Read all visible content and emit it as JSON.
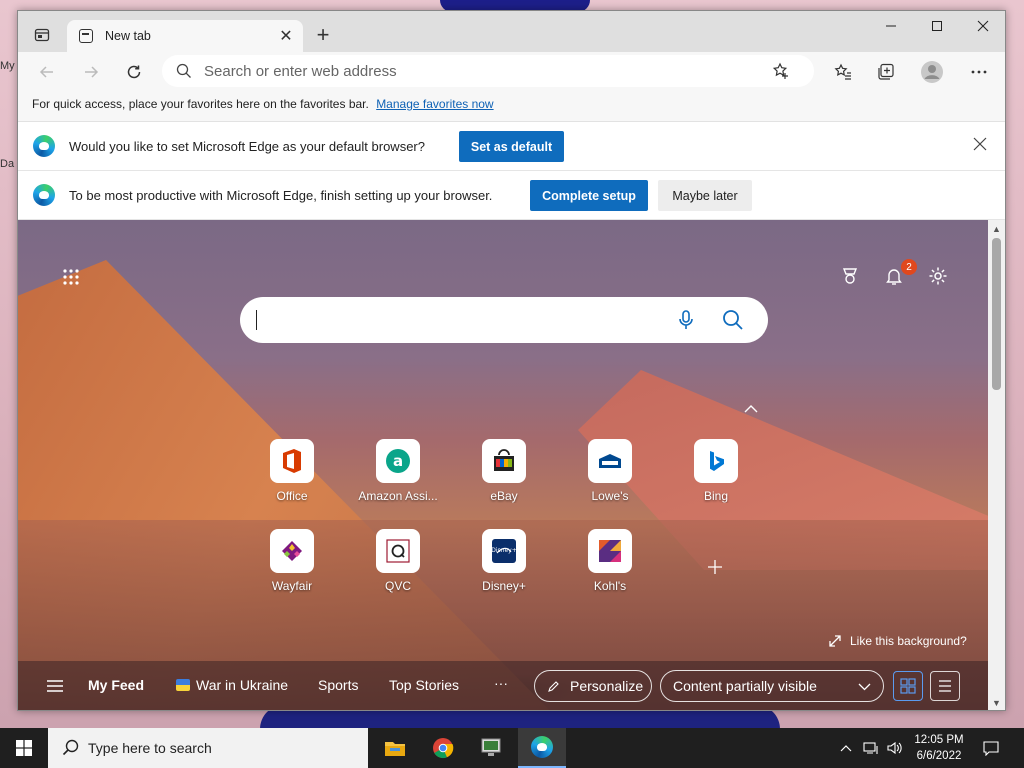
{
  "desktop": {
    "labels": [
      "My",
      "Da"
    ]
  },
  "browser": {
    "tab": {
      "title": "New tab",
      "close": "✕"
    },
    "new_tab": "+",
    "address": {
      "placeholder": "Search or enter web address"
    },
    "favorites_bar": {
      "text": "For quick access, place your favorites here on the favorites bar.",
      "link": "Manage favorites now"
    },
    "infobar_default": {
      "text": "Would you like to set Microsoft Edge as your default browser?",
      "button": "Set as default"
    },
    "infobar_setup": {
      "text": "To be most productive with Microsoft Edge, finish setting up your browser.",
      "primary": "Complete setup",
      "secondary": "Maybe later"
    }
  },
  "ntp": {
    "notifications_count": "2",
    "search_placeholder": "",
    "tiles": [
      {
        "label": "Office",
        "icon": "office-icon",
        "color": "#d83b01"
      },
      {
        "label": "Amazon Assi...",
        "icon": "amazon-assistant-icon",
        "color": "#0aa58a"
      },
      {
        "label": "eBay",
        "icon": "ebay-icon",
        "color": "#e53238"
      },
      {
        "label": "Lowe's",
        "icon": "lowes-icon",
        "color": "#004990"
      },
      {
        "label": "Bing",
        "icon": "bing-icon",
        "color": "#0078d4"
      },
      {
        "label": "Wayfair",
        "icon": "wayfair-icon",
        "color": "#7f187f"
      },
      {
        "label": "QVC",
        "icon": "qvc-icon",
        "color": "#9e1b32"
      },
      {
        "label": "Disney+",
        "icon": "disney-plus-icon",
        "color": "#0b2f6b"
      },
      {
        "label": "Kohl's",
        "icon": "kohls-icon",
        "color": "#5a2d82"
      }
    ],
    "like_background": "Like this background?",
    "feed": {
      "my_feed": "My Feed",
      "items": [
        "War in Ukraine",
        "Sports",
        "Top Stories"
      ],
      "more": "···",
      "personalize": "Personalize",
      "content_visibility": "Content partially visible"
    }
  },
  "taskbar": {
    "search_placeholder": "Type here to search",
    "time": "12:05 PM",
    "date": "6/6/2022"
  }
}
